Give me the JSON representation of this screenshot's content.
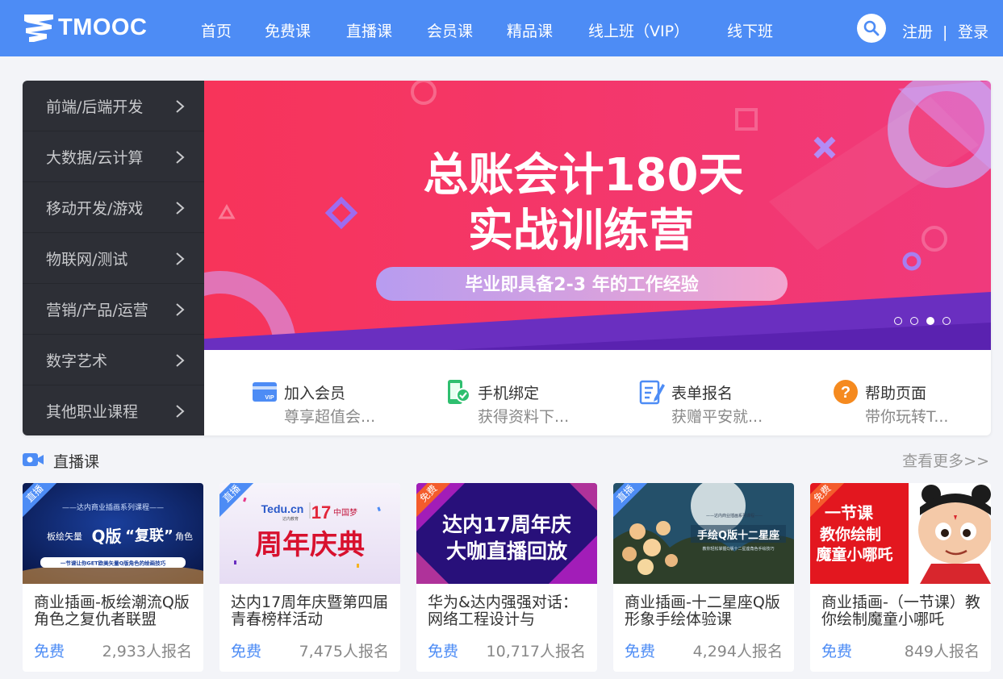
{
  "header": {
    "logo_text": "TMOOC",
    "nav": [
      "首页",
      "免费课",
      "直播课",
      "会员课",
      "精品课",
      "线上班（VIP）",
      "线下班"
    ],
    "register": "注册",
    "separator": "|",
    "login": "登录"
  },
  "sidebar": {
    "items": [
      "前端/后端开发",
      "大数据/云计算",
      "移动开发/游戏",
      "物联网/测试",
      "营销/产品/运营",
      "数字艺术",
      "其他职业课程"
    ]
  },
  "banner": {
    "title_line1": "总账会计180天",
    "title_line2": "实战训练营",
    "subtitle": "毕业即具备2-3 年的工作经验",
    "active_dot": 3,
    "dot_count": 4
  },
  "quick_links": [
    {
      "title": "加入会员",
      "sub": "尊享超值会...",
      "icon": "vip-card-icon"
    },
    {
      "title": "手机绑定",
      "sub": "获得资料下...",
      "icon": "phone-check-icon"
    },
    {
      "title": "表单报名",
      "sub": "获赠平安就...",
      "icon": "form-edit-icon"
    },
    {
      "title": "帮助页面",
      "sub": "带你玩转T...",
      "icon": "help-icon"
    }
  ],
  "live_section": {
    "title": "直播课",
    "more": "查看更多>>"
  },
  "courses": [
    {
      "tag": "直播",
      "title": "商业插画-板绘潮流Q版角色之复仇者联盟",
      "price": "免费",
      "enroll": "2,933人报名",
      "thumb": {
        "top": "——达内商业插画系列课程——",
        "main": "板绘矢量",
        "q": "Q版",
        "quote": "“复联”",
        "tail": "角色",
        "bar": "一节课让你GET欧美矢量Q版角色的绘画技巧"
      }
    },
    {
      "tag": "直播",
      "title": "达内17周年庆暨第四届青春榜样活动",
      "price": "免费",
      "enroll": "7,475人报名",
      "thumb": {
        "brand": "Tedu.cn",
        "brand_sub": "达内教育",
        "num": "17",
        "dream": "中国梦",
        "main": "周年庆典"
      }
    },
    {
      "tag": "免费",
      "title": "华为&达内强强对话：网络工程设计与",
      "price": "免费",
      "enroll": "10,717人报名",
      "thumb": {
        "line1": "达内17周年庆",
        "line2": "大咖直播回放"
      }
    },
    {
      "tag": "直播",
      "title": "商业插画-十二星座Q版形象手绘体验课",
      "price": "免费",
      "enroll": "4,294人报名",
      "thumb": {
        "top": "——达内商业插画系列课程——",
        "main": "手绘Q版十二星座",
        "bar": "教你轻松掌握Q版十二星座角色手绘技巧"
      }
    },
    {
      "tag": "免费",
      "title": "商业插画-（一节课）教你绘制魔童小哪吒",
      "price": "免费",
      "enroll": "849人报名",
      "thumb": {
        "line1": "一节课",
        "line2": "教你绘制",
        "line3": "魔童小哪吒"
      }
    }
  ],
  "colors": {
    "header_bg": "#4d8cf5",
    "sidebar_bg": "#2d2f36",
    "accent_blue": "#4d8cf5",
    "free_tag": "#f45c2c",
    "banner_pink": "#f7345a",
    "banner_purple": "#6a2fc0"
  }
}
